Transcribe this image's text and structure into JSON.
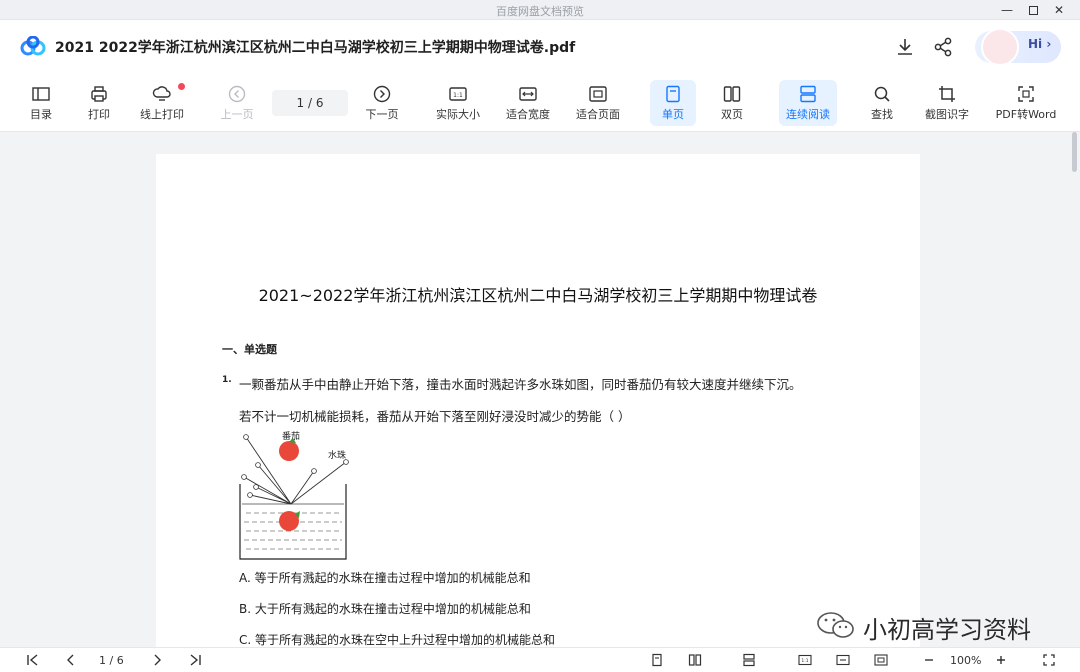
{
  "os_window": {
    "title": "百度网盘文档预览"
  },
  "header": {
    "doc_title": "2021  2022学年浙江杭州滨江区杭州二中白马湖学校初三上学期期中物理试卷.pdf",
    "assistant_label": "Hi"
  },
  "toolbar": {
    "items": [
      {
        "label": "目录",
        "icon": "toc-icon"
      },
      {
        "label": "打印",
        "icon": "printer-icon"
      },
      {
        "label": "线上打印",
        "icon": "cloud-print-icon"
      },
      {
        "label": "上一页",
        "icon": "prev-page-icon"
      },
      {
        "label": "下一页",
        "icon": "next-page-icon"
      },
      {
        "label": "实际大小",
        "icon": "actual-size-icon"
      },
      {
        "label": "适合宽度",
        "icon": "fit-width-icon"
      },
      {
        "label": "适合页面",
        "icon": "fit-page-icon"
      },
      {
        "label": "单页",
        "icon": "single-page-icon"
      },
      {
        "label": "双页",
        "icon": "double-page-icon"
      },
      {
        "label": "连续阅读",
        "icon": "continuous-icon"
      },
      {
        "label": "查找",
        "icon": "search-icon"
      },
      {
        "label": "截图识字",
        "icon": "crop-ocr-icon"
      },
      {
        "label": "PDF转Word",
        "icon": "pdf-to-word-icon"
      }
    ],
    "page_indicator": "1  /  6"
  },
  "document": {
    "title": "2021~2022学年浙江杭州滨江区杭州二中白马湖学校初三上学期期中物理试卷",
    "section": "一、单选题",
    "question_number": "1.",
    "question_line1": "一颗番茄从手中由静止开始下落，撞击水面时溅起许多水珠如图，同时番茄仍有较大速度并继续下沉。",
    "question_line2": "若不计一切机械能损耗，番茄从开始下落至刚好浸没时减少的势能（        ）",
    "figure_label_tomato": "番茄",
    "figure_label_droplet": "水珠",
    "options": [
      "A. 等于所有溅起的水珠在撞击过程中增加的机械能总和",
      "B. 大于所有溅起的水珠在撞击过程中增加的机械能总和",
      "C. 等于所有溅起的水珠在空中上升过程中增加的机械能总和"
    ]
  },
  "footer": {
    "page_indicator": "1  /  6",
    "zoom": "100%"
  },
  "watermark": {
    "text": "小初高学习资料"
  },
  "colors": {
    "accent": "#1677ff",
    "active_bg": "#e6f2ff",
    "notification": "#f5475b"
  }
}
